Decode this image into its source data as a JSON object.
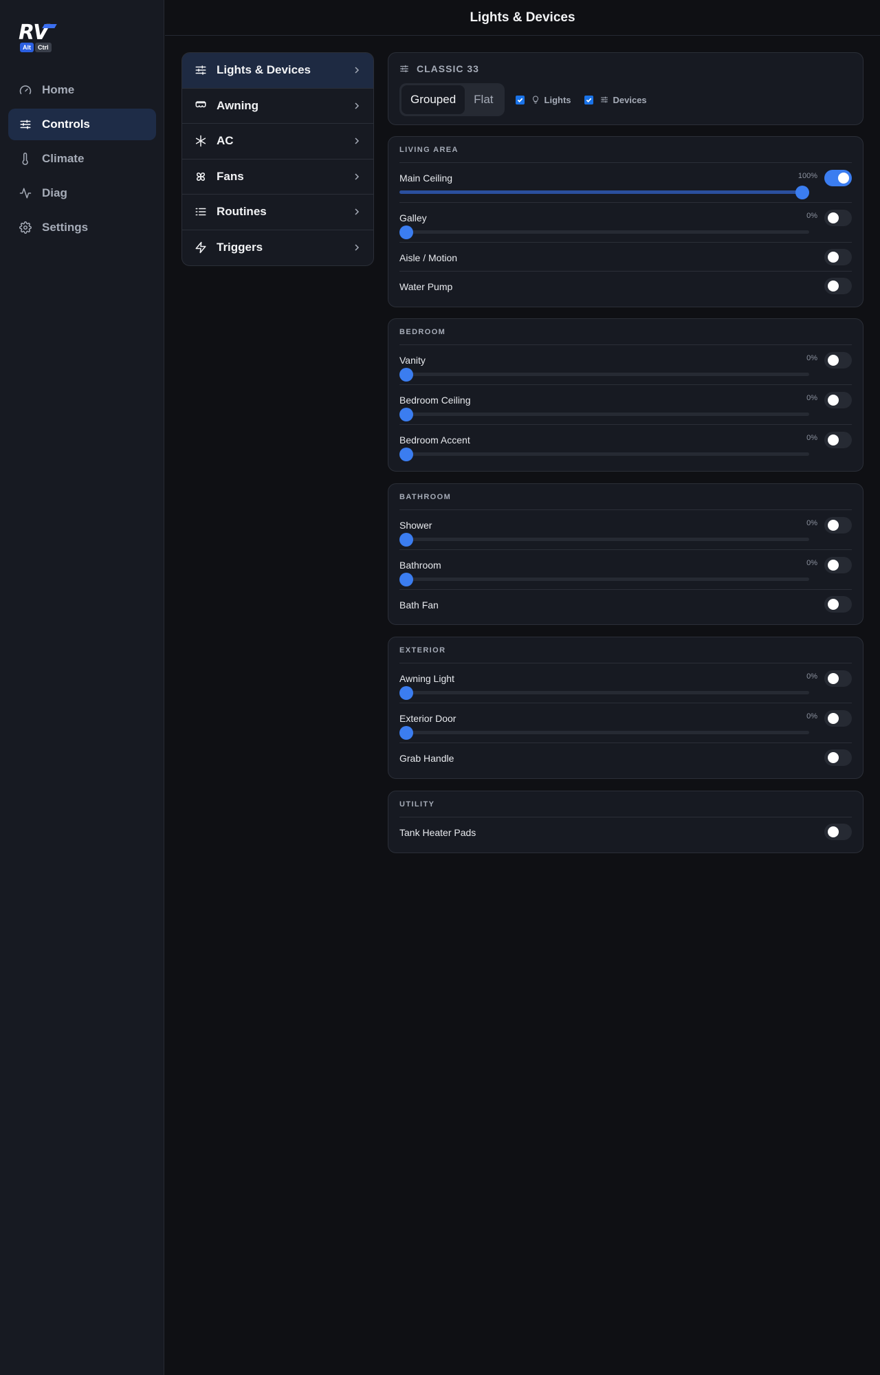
{
  "logo": {
    "main": "RV",
    "badge1": "Alt",
    "badge2": "Ctrl"
  },
  "nav": [
    {
      "label": "Home",
      "icon": "gauge-icon"
    },
    {
      "label": "Controls",
      "icon": "sliders-icon",
      "active": true
    },
    {
      "label": "Climate",
      "icon": "thermometer-icon"
    },
    {
      "label": "Diag",
      "icon": "activity-icon"
    },
    {
      "label": "Settings",
      "icon": "gear-icon"
    }
  ],
  "header": {
    "title": "Lights & Devices"
  },
  "submenu": [
    {
      "label": "Lights & Devices",
      "icon": "sliders-icon",
      "active": true
    },
    {
      "label": "Awning",
      "icon": "awning-icon"
    },
    {
      "label": "AC",
      "icon": "snowflake-icon"
    },
    {
      "label": "Fans",
      "icon": "fan-icon"
    },
    {
      "label": "Routines",
      "icon": "list-icon"
    },
    {
      "label": "Triggers",
      "icon": "lightning-icon"
    }
  ],
  "topcard": {
    "title": "CLASSIC 33",
    "grouped": "Grouped",
    "flat": "Flat",
    "lights": "Lights",
    "devices": "Devices"
  },
  "sections": [
    {
      "title": "LIVING AREA",
      "rows": [
        {
          "name": "Main Ceiling",
          "dimmer": true,
          "pct": "100%",
          "level": 1.0,
          "on": true
        },
        {
          "name": "Galley",
          "dimmer": true,
          "pct": "0%",
          "level": 0,
          "on": false
        },
        {
          "name": "Aisle / Motion",
          "dimmer": false,
          "on": false
        },
        {
          "name": "Water Pump",
          "dimmer": false,
          "on": false
        }
      ]
    },
    {
      "title": "BEDROOM",
      "rows": [
        {
          "name": "Vanity",
          "dimmer": true,
          "pct": "0%",
          "level": 0,
          "on": false
        },
        {
          "name": "Bedroom Ceiling",
          "dimmer": true,
          "pct": "0%",
          "level": 0,
          "on": false
        },
        {
          "name": "Bedroom Accent",
          "dimmer": true,
          "pct": "0%",
          "level": 0,
          "on": false
        }
      ]
    },
    {
      "title": "BATHROOM",
      "rows": [
        {
          "name": "Shower",
          "dimmer": true,
          "pct": "0%",
          "level": 0,
          "on": false
        },
        {
          "name": "Bathroom",
          "dimmer": true,
          "pct": "0%",
          "level": 0,
          "on": false
        },
        {
          "name": "Bath Fan",
          "dimmer": false,
          "on": false
        }
      ]
    },
    {
      "title": "EXTERIOR",
      "rows": [
        {
          "name": "Awning Light",
          "dimmer": true,
          "pct": "0%",
          "level": 0,
          "on": false
        },
        {
          "name": "Exterior Door",
          "dimmer": true,
          "pct": "0%",
          "level": 0,
          "on": false
        },
        {
          "name": "Grab Handle",
          "dimmer": false,
          "on": false
        }
      ]
    },
    {
      "title": "UTILITY",
      "rows": [
        {
          "name": "Tank Heater Pads",
          "dimmer": false,
          "on": false
        }
      ]
    }
  ],
  "colors": {
    "accent": "#3b7df0",
    "background": "#0f1014",
    "panel": "#171a22"
  }
}
